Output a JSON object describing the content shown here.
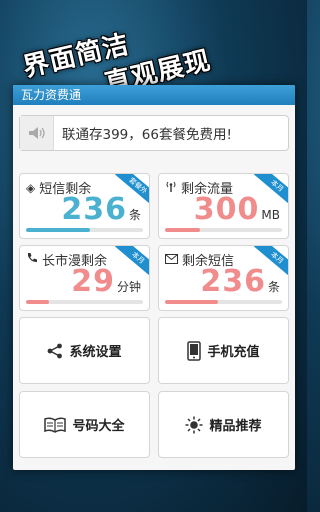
{
  "promo": {
    "line1": "界面简洁",
    "line2": "直观展现"
  },
  "app": {
    "title": "瓦力资费通"
  },
  "notice": {
    "text": "联通存399，66套餐免费用!"
  },
  "cards": [
    {
      "label": "短信剩余",
      "badge": "套餐外",
      "value": "236",
      "unit": "条",
      "color": "#4ab2d0",
      "fill_color": "#4ab2d0",
      "progress": 0.55
    },
    {
      "label": "剩余流量",
      "badge": "本月",
      "value": "300",
      "unit": "MB",
      "color": "#f08c8c",
      "fill_color": "#f08c8c",
      "progress": 0.3
    },
    {
      "label": "长市漫剩余",
      "badge": "本月",
      "value": "29",
      "unit": "分钟",
      "color": "#f08c8c",
      "fill_color": "#f08c8c",
      "progress": 0.2
    },
    {
      "label": "剩余短信",
      "badge": "本月",
      "value": "236",
      "unit": "条",
      "color": "#f08c8c",
      "fill_color": "#f08c8c",
      "progress": 0.45
    }
  ],
  "menu": [
    {
      "label": "系统设置",
      "icon": "share-icon"
    },
    {
      "label": "手机充值",
      "icon": "phone-icon"
    },
    {
      "label": "号码大全",
      "icon": "book-icon"
    },
    {
      "label": "精品推荐",
      "icon": "sun-icon"
    }
  ]
}
